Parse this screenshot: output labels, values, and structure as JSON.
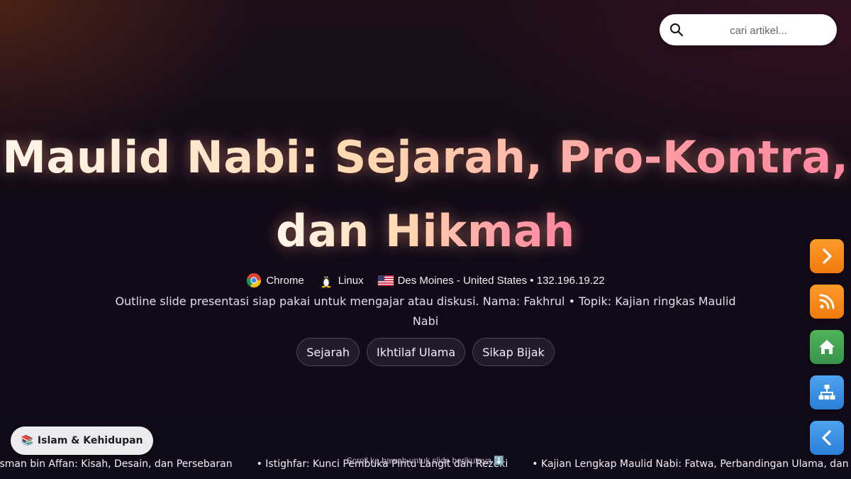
{
  "search": {
    "placeholder": "cari artikel..."
  },
  "hero": {
    "title_line1": "Maulid Nabi: Sejarah, Pro-Kontra,",
    "title_line2": "dan Hikmah"
  },
  "meta": {
    "browser": "Chrome",
    "os": "Linux",
    "location": "Des Moines - United States • 132.196.19.22"
  },
  "description": "Outline slide presentasi siap pakai untuk mengajar atau diskusi. Nama: Fakhrul • Topik: Kajian ringkas Maulid Nabi",
  "tags": [
    "Sejarah",
    "Ikhtilaf Ulama",
    "Sikap Bijak"
  ],
  "category": {
    "emoji": "📚",
    "label": "Islam & Kehidupan"
  },
  "scroll_hint": "Scroll ke bawah untuk slide berikutnya ⬇️",
  "ticker": [
    "tsman bin Affan: Kisah, Desain, dan Persebaran",
    "• Istighfar: Kunci Pembuka Pintu Langit dan Rezeki",
    "• Kajian Lengkap Maulid Nabi: Fatwa, Perbandingan Ulama, dan Sej"
  ],
  "side_buttons": [
    {
      "name": "next",
      "icon": "chevron-right-icon",
      "color": "#f58a1c"
    },
    {
      "name": "rss",
      "icon": "rss-icon",
      "color": "#f58a1c"
    },
    {
      "name": "home",
      "icon": "home-icon",
      "color": "#43a64f"
    },
    {
      "name": "sitemap",
      "icon": "sitemap-icon",
      "color": "#3a91e4"
    },
    {
      "name": "prev",
      "icon": "chevron-left-icon",
      "color": "#3a91e4"
    }
  ]
}
